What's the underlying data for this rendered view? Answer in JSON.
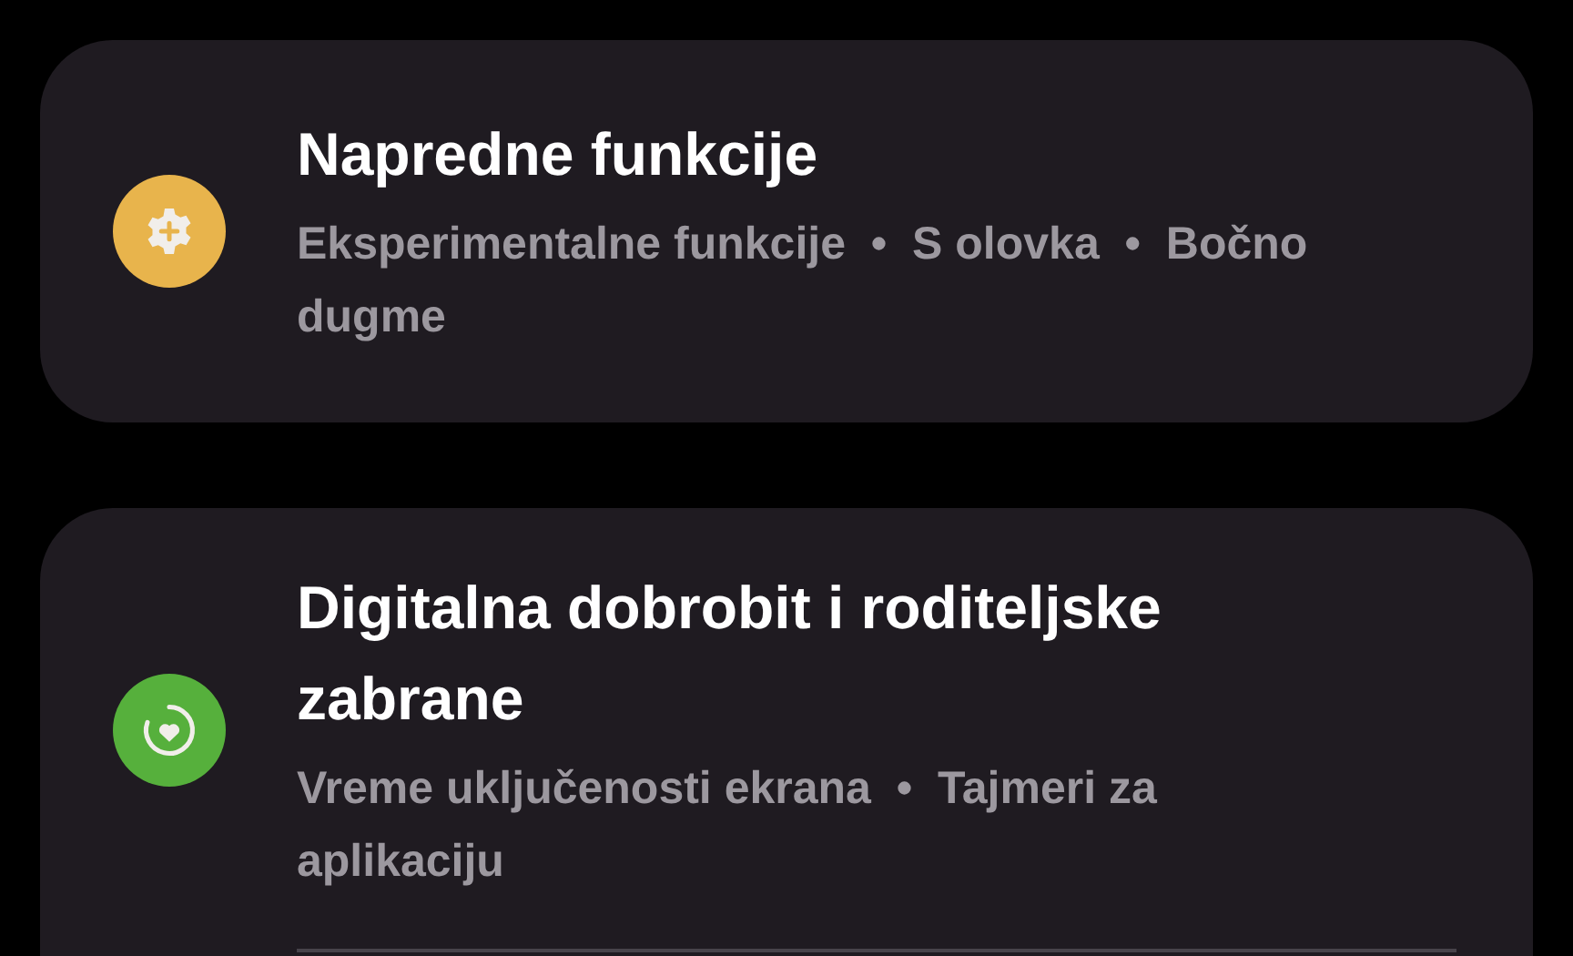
{
  "settings": [
    {
      "kind": "gear",
      "title": "Napredne funkcije",
      "subtitle": "Eksperimentalne funkcije  •  S olovka  •  Bočno dugme",
      "color": "#e8b44c"
    },
    {
      "kind": "heart",
      "title": "Digitalna dobrobit i roditeljske zabrane",
      "subtitle": "Vreme uključenosti ekrana  •  Tajmeri za aplikaciju",
      "color": "#56b03c"
    }
  ]
}
